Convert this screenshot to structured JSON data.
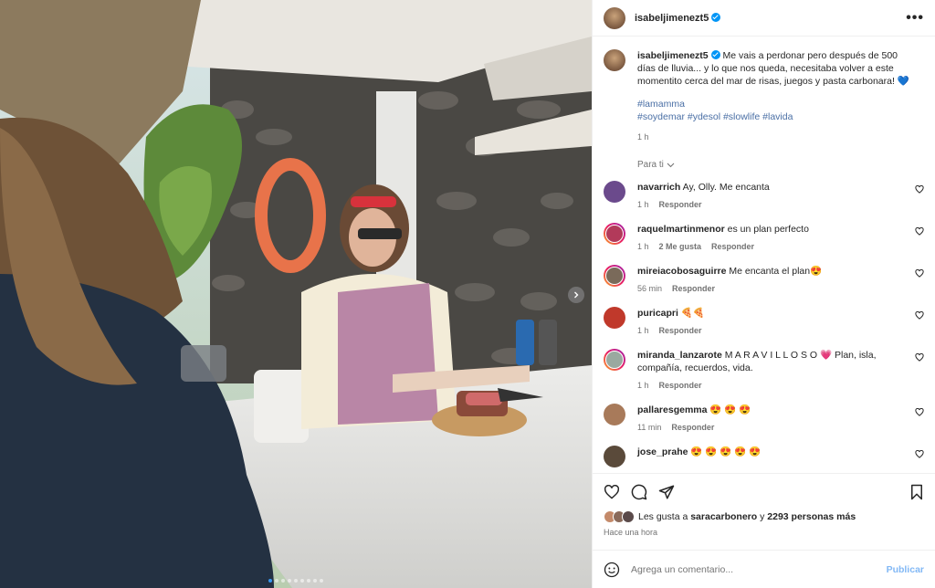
{
  "post": {
    "username": "isabeljimenezt5",
    "caption": "Me vais a perdonar pero después de 500 días de lluvia... y lo que nos queda, necesitaba volver a este momentito cerca del mar de risas, juegos y pasta carbonara! 💙",
    "hashtag_line1": "#lamamma",
    "hashtag_line2": "#soydemar #ydesol #slowlife #lavida",
    "time": "1 h",
    "sort_label": "Para ti",
    "more_icon": "more-options-icon"
  },
  "comments": [
    {
      "user": "navarrich",
      "text": "Ay, Olly. Me encanta",
      "time": "1 h",
      "likes": "",
      "reply": "Responder",
      "avatar_color": "#6b4a8c",
      "ring": false
    },
    {
      "user": "raquelmartinmenor",
      "text": "es un plan perfecto",
      "time": "1 h",
      "likes": "2 Me gusta",
      "reply": "Responder",
      "avatar_color": "#b23a5a",
      "ring": true
    },
    {
      "user": "mireiacobosaguirre",
      "text": "Me encanta el plan😍",
      "time": "56 min",
      "likes": "",
      "reply": "Responder",
      "avatar_color": "#7a6a5a",
      "ring": true
    },
    {
      "user": "puricapri",
      "text": "🍕🍕",
      "time": "1 h",
      "likes": "",
      "reply": "Responder",
      "avatar_color": "#c0392b",
      "ring": false
    },
    {
      "user": "miranda_lanzarote",
      "text": "M A R A V I L L O S O 💗 Plan, isla, compañía, recuerdos, vida.",
      "time": "1 h",
      "likes": "",
      "reply": "Responder",
      "avatar_color": "#9aa9a0",
      "ring": true
    },
    {
      "user": "pallaresgemma",
      "text": "😍 😍 😍",
      "time": "11 min",
      "likes": "",
      "reply": "Responder",
      "avatar_color": "#a87a5a",
      "ring": false
    },
    {
      "user": "jose_prahe",
      "text": "😍 😍 😍 😍 😍",
      "time": "",
      "likes": "",
      "reply": "",
      "avatar_color": "#5a4a3a",
      "ring": false
    }
  ],
  "likes": {
    "prefix": "Les gusta a",
    "user": "saracarbonero",
    "middle": "y",
    "count": "2293 personas más"
  },
  "posted_ago": "Hace una hora",
  "add_comment": {
    "placeholder": "Agrega un comentario...",
    "publish": "Publicar"
  },
  "carousel": {
    "slides": 9,
    "active": 0
  },
  "colors": {
    "accent": "#0095f6",
    "publish": "#82b8f5",
    "hashtag": "#4a6fa5",
    "muted": "#737373"
  }
}
